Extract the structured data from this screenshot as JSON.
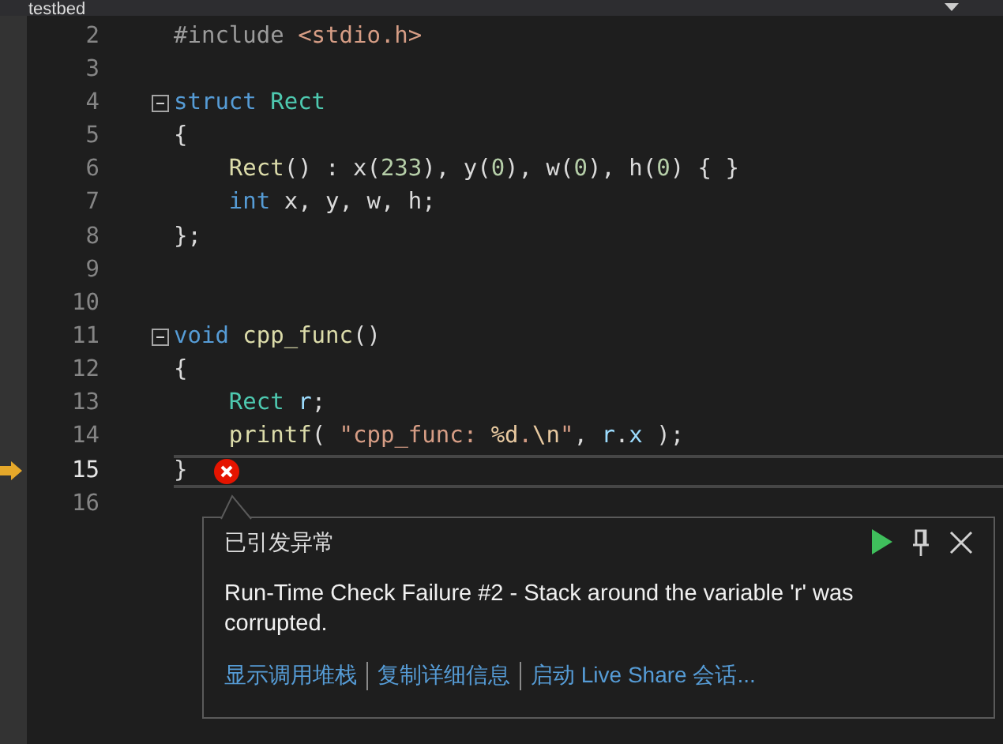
{
  "tab": {
    "title": "testbed"
  },
  "lines": [
    {
      "number": "2",
      "fold": false,
      "current": false,
      "error": false,
      "tokens": [
        {
          "text": "#include",
          "kind": "macro"
        },
        {
          "text": " <stdio.h>",
          "kind": "str"
        }
      ]
    },
    {
      "number": "3",
      "fold": false,
      "current": false,
      "error": false
    },
    {
      "number": "4",
      "fold": true,
      "current": false,
      "error": false,
      "tokens": [
        {
          "text": "struct",
          "kind": "kw"
        },
        {
          "text": " Rect",
          "kind": "type"
        }
      ]
    },
    {
      "number": "5",
      "fold": false,
      "current": false,
      "error": false,
      "tokens": [
        {
          "text": "{",
          "kind": "plain"
        }
      ]
    },
    {
      "number": "6",
      "fold": false,
      "current": false,
      "error": false,
      "tokens": [
        {
          "text": "    Rect",
          "kind": "fn"
        },
        {
          "text": "() : x(",
          "kind": "plain"
        },
        {
          "text": "233",
          "kind": "num"
        },
        {
          "text": "), y(",
          "kind": "plain"
        },
        {
          "text": "0",
          "kind": "num"
        },
        {
          "text": "), w(",
          "kind": "plain"
        },
        {
          "text": "0",
          "kind": "num"
        },
        {
          "text": "), h(",
          "kind": "plain"
        },
        {
          "text": "0",
          "kind": "num"
        },
        {
          "text": ") { }",
          "kind": "plain"
        }
      ]
    },
    {
      "number": "7",
      "fold": false,
      "current": false,
      "error": false,
      "tokens": [
        {
          "text": "    int",
          "kind": "kw"
        },
        {
          "text": " x, y, w, h;",
          "kind": "plain"
        }
      ]
    },
    {
      "number": "8",
      "fold": false,
      "current": false,
      "error": false,
      "tokens": [
        {
          "text": "};",
          "kind": "plain"
        }
      ]
    },
    {
      "number": "9",
      "fold": false,
      "current": false,
      "error": false
    },
    {
      "number": "10",
      "fold": false,
      "current": false,
      "error": false
    },
    {
      "number": "11",
      "fold": true,
      "current": false,
      "error": false,
      "tokens": [
        {
          "text": "void",
          "kind": "kw"
        },
        {
          "text": " cpp_func",
          "kind": "fn"
        },
        {
          "text": "()",
          "kind": "plain"
        }
      ]
    },
    {
      "number": "12",
      "fold": false,
      "current": false,
      "error": false,
      "tokens": [
        {
          "text": "{",
          "kind": "plain"
        }
      ]
    },
    {
      "number": "13",
      "fold": false,
      "current": false,
      "error": false,
      "tokens": [
        {
          "text": "    Rect",
          "kind": "type"
        },
        {
          "text": " r",
          "kind": "var"
        },
        {
          "text": ";",
          "kind": "plain"
        }
      ]
    },
    {
      "number": "14",
      "fold": false,
      "current": false,
      "error": false,
      "tokens": [
        {
          "text": "    printf",
          "kind": "fn"
        },
        {
          "text": "( ",
          "kind": "plain"
        },
        {
          "text": "\"cpp_func: ",
          "kind": "str"
        },
        {
          "text": "%d",
          "kind": "fmt"
        },
        {
          "text": ".",
          "kind": "str"
        },
        {
          "text": "\\n",
          "kind": "fmt"
        },
        {
          "text": "\"",
          "kind": "str"
        },
        {
          "text": ", ",
          "kind": "plain"
        },
        {
          "text": "r",
          "kind": "var"
        },
        {
          "text": ".",
          "kind": "plain"
        },
        {
          "text": "x",
          "kind": "var"
        },
        {
          "text": " );",
          "kind": "plain"
        }
      ]
    },
    {
      "number": "15",
      "fold": false,
      "current": true,
      "error": true,
      "tokens": [
        {
          "text": "}",
          "kind": "plain"
        }
      ]
    },
    {
      "number": "16",
      "fold": false,
      "current": false,
      "error": false
    }
  ],
  "exception": {
    "title": "已引发异常",
    "message": "Run-Time Check Failure #2 - Stack around the variable 'r' was corrupted.",
    "links": [
      "显示调用堆栈",
      "复制详细信息",
      "启动 Live Share 会话..."
    ]
  }
}
